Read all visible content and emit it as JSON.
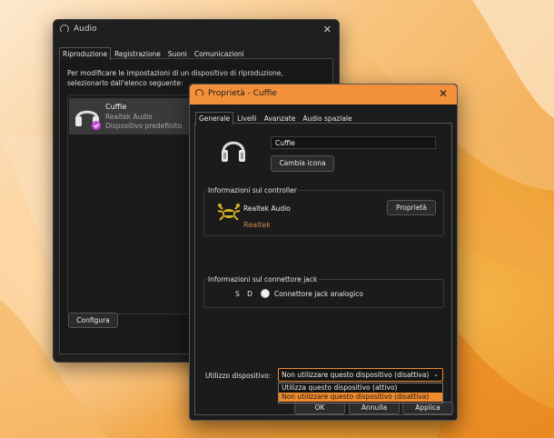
{
  "audio_window": {
    "title": "Audio",
    "tabs": [
      "Riproduzione",
      "Registrazione",
      "Suoni",
      "Comunicazioni"
    ],
    "description": "Per modificare le impostazioni di un dispositivo di riproduzione, selezionarlo dall'elenco seguente:",
    "device": {
      "name": "Cuffie",
      "driver": "Realtek Audio",
      "status": "Dispositivo predefinito"
    },
    "configure_label": "Configura"
  },
  "properties_window": {
    "title": "Proprietà - Cuffie",
    "tabs": [
      "Generale",
      "Livelli",
      "Avanzate",
      "Audio spaziale"
    ],
    "device_name_value": "Cuffie",
    "change_icon_label": "Cambia icona",
    "controller_group_title": "Informazioni sul controller",
    "controller_name": "Realtek Audio",
    "controller_brand": "Realtek",
    "controller_properties_label": "Proprietà",
    "jack_group_title": "Informazioni sul connettore jack",
    "jack_side_label": "S D",
    "jack_connector_label": "Connettore jack analogico",
    "usage_label": "Utilizzo dispositivo:",
    "usage_selected": "Non utilizzare questo dispositivo (disattiva)",
    "usage_options": [
      "Utilizza questo dispositivo (attivo)",
      "Non utilizzare questo dispositivo (disattiva)"
    ],
    "ok_label": "OK",
    "cancel_label": "Annulla",
    "apply_label": "Applica"
  },
  "colors": {
    "accent": "#f08a2b",
    "title_bar": "#f3913a",
    "default_badge": "#c64bd8"
  }
}
